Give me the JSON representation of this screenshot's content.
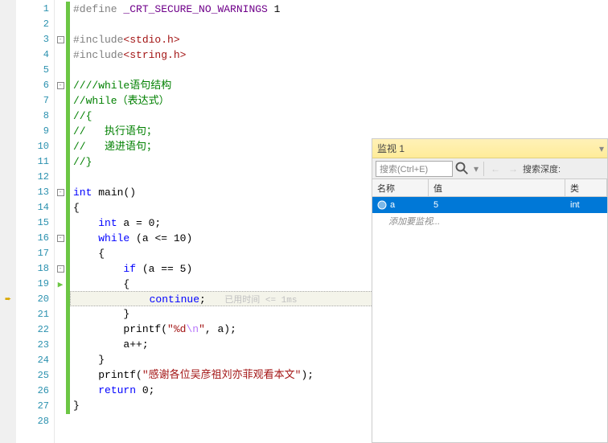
{
  "editor": {
    "lines": [
      {
        "n": 1,
        "green": true,
        "fold": "",
        "tokens": [
          [
            "pp",
            "#define "
          ],
          [
            "mac",
            "_CRT_SECURE_NO_WARNINGS"
          ],
          [
            "",
            ""
          ],
          [
            "",
            " 1"
          ]
        ]
      },
      {
        "n": 2,
        "green": true,
        "fold": "",
        "tokens": []
      },
      {
        "n": 3,
        "green": true,
        "fold": "-",
        "tokens": [
          [
            "pp",
            "#include"
          ],
          [
            "str",
            "<stdio.h>"
          ]
        ]
      },
      {
        "n": 4,
        "green": true,
        "fold": "",
        "tokens": [
          [
            "pp",
            "#include"
          ],
          [
            "str",
            "<string.h>"
          ]
        ]
      },
      {
        "n": 5,
        "green": true,
        "fold": "",
        "tokens": []
      },
      {
        "n": 6,
        "green": true,
        "fold": "-",
        "tokens": [
          [
            "cmt",
            "////while语句结构"
          ]
        ]
      },
      {
        "n": 7,
        "green": true,
        "fold": "",
        "tokens": [
          [
            "cmt",
            "//while（表达式）"
          ]
        ]
      },
      {
        "n": 8,
        "green": true,
        "fold": "",
        "tokens": [
          [
            "cmt",
            "//{"
          ]
        ]
      },
      {
        "n": 9,
        "green": true,
        "fold": "",
        "tokens": [
          [
            "cmt",
            "//   执行语句；"
          ]
        ]
      },
      {
        "n": 10,
        "green": true,
        "fold": "",
        "tokens": [
          [
            "cmt",
            "//   递进语句；"
          ]
        ]
      },
      {
        "n": 11,
        "green": true,
        "fold": "",
        "tokens": [
          [
            "cmt",
            "//}"
          ]
        ]
      },
      {
        "n": 12,
        "green": true,
        "fold": "",
        "tokens": []
      },
      {
        "n": 13,
        "green": true,
        "fold": "-",
        "tokens": [
          [
            "kw",
            "int"
          ],
          [
            "",
            " "
          ],
          [
            "func",
            "main"
          ],
          [
            "",
            "()"
          ]
        ]
      },
      {
        "n": 14,
        "green": true,
        "fold": "",
        "tokens": [
          [
            "",
            "{"
          ]
        ]
      },
      {
        "n": 15,
        "green": true,
        "fold": "",
        "tokens": [
          [
            "",
            "    "
          ],
          [
            "kw",
            "int"
          ],
          [
            "",
            " a = 0;"
          ]
        ]
      },
      {
        "n": 16,
        "green": true,
        "fold": "-",
        "tokens": [
          [
            "",
            "    "
          ],
          [
            "kw",
            "while"
          ],
          [
            "",
            " (a <= 10)"
          ]
        ]
      },
      {
        "n": 17,
        "green": true,
        "fold": "",
        "tokens": [
          [
            "",
            "    {"
          ]
        ]
      },
      {
        "n": 18,
        "green": true,
        "fold": "-",
        "tokens": [
          [
            "",
            "        "
          ],
          [
            "kw",
            "if"
          ],
          [
            "",
            " (a == 5)"
          ]
        ]
      },
      {
        "n": 19,
        "green": true,
        "fold": "step",
        "tokens": [
          [
            "",
            "        {"
          ]
        ]
      },
      {
        "n": 20,
        "green": true,
        "fold": "",
        "hl": true,
        "bp": "arrow",
        "tokens": [
          [
            "",
            "            "
          ],
          [
            "kw",
            "continue"
          ],
          [
            "",
            ";   "
          ],
          [
            "hint",
            "已用时间 <= 1ms"
          ]
        ]
      },
      {
        "n": 21,
        "green": true,
        "fold": "",
        "tokens": [
          [
            "",
            "        }"
          ]
        ]
      },
      {
        "n": 22,
        "green": true,
        "fold": "",
        "tokens": [
          [
            "",
            "        "
          ],
          [
            "func",
            "printf"
          ],
          [
            "",
            "("
          ],
          [
            "str",
            "\"%d"
          ],
          [
            "esc",
            "\\n"
          ],
          [
            "str",
            "\""
          ],
          [
            "",
            ", a);"
          ]
        ]
      },
      {
        "n": 23,
        "green": true,
        "fold": "",
        "tokens": [
          [
            "",
            "        a++;"
          ]
        ]
      },
      {
        "n": 24,
        "green": true,
        "fold": "",
        "tokens": [
          [
            "",
            "    }"
          ]
        ]
      },
      {
        "n": 25,
        "green": true,
        "fold": "",
        "tokens": [
          [
            "",
            "    "
          ],
          [
            "func",
            "printf"
          ],
          [
            "",
            "("
          ],
          [
            "str",
            "\"感谢各位吴彦祖刘亦菲观看本文\""
          ],
          [
            "",
            ");"
          ]
        ]
      },
      {
        "n": 26,
        "green": true,
        "fold": "",
        "tokens": [
          [
            "",
            "    "
          ],
          [
            "kw",
            "return"
          ],
          [
            "",
            " 0;"
          ]
        ]
      },
      {
        "n": 27,
        "green": true,
        "fold": "",
        "tokens": [
          [
            "",
            "}"
          ]
        ]
      },
      {
        "n": 28,
        "green": false,
        "fold": "",
        "tokens": []
      }
    ]
  },
  "watch": {
    "title": "监视 1",
    "search_placeholder": "搜索(Ctrl+E)",
    "depth_label": "搜索深度:",
    "columns": {
      "name": "名称",
      "value": "值",
      "type": "类"
    },
    "rows": [
      {
        "name": "a",
        "value": "5",
        "type": "int",
        "selected": true
      }
    ],
    "placeholder": "添加要监视..."
  }
}
